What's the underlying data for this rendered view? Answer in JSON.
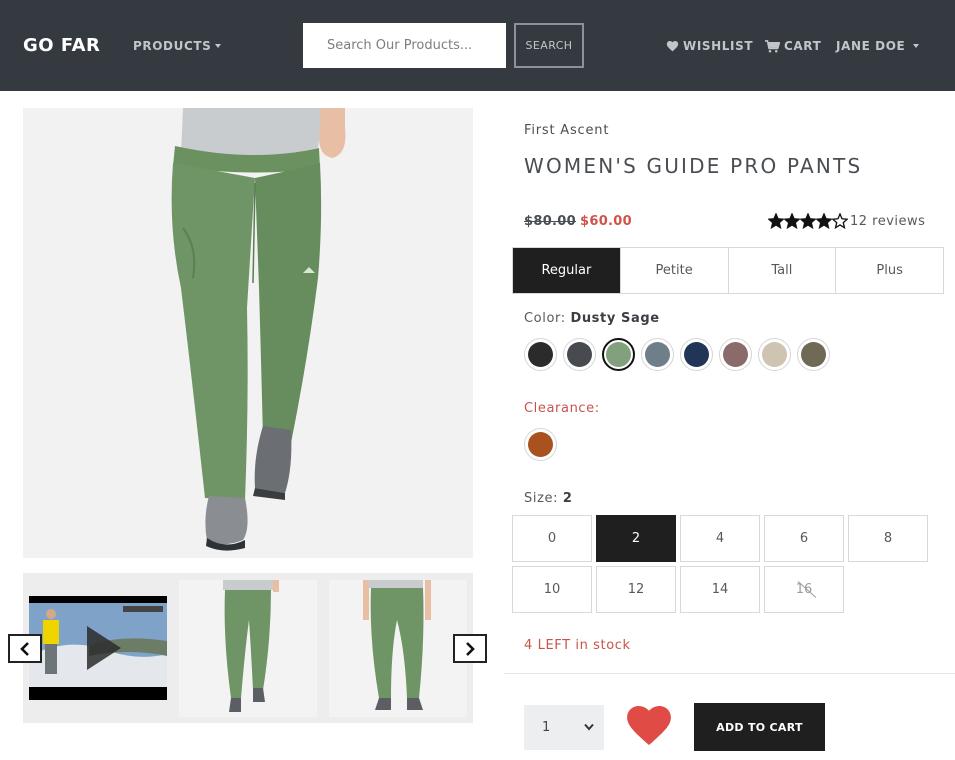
{
  "nav": {
    "brand": "GO FAR",
    "products_label": "PRODUCTS",
    "search_placeholder": "Search Our Products...",
    "search_button": "SEARCH",
    "wishlist_label": "WISHLIST",
    "cart_label": "CART",
    "user_label": "JANE DOE"
  },
  "gallery": {
    "thumbnails": [
      "video",
      "pants-front",
      "pants-back"
    ],
    "colors": {
      "background": "#f2f2f2",
      "pants": "#6e9465"
    }
  },
  "product": {
    "brand": "First Ascent",
    "title": "WOMEN'S GUIDE PRO PANTS",
    "price_old": "$80.00",
    "price_new": "$60.00",
    "rating": 4,
    "rating_max": 5,
    "reviews_label": "12 reviews",
    "fit_tabs": [
      {
        "label": "Regular",
        "active": true
      },
      {
        "label": "Petite",
        "active": false
      },
      {
        "label": "Tall",
        "active": false
      },
      {
        "label": "Plus",
        "active": false
      }
    ],
    "color_label": "Color:",
    "color_selected": "Dusty Sage",
    "colors": [
      {
        "hex": "#2b2b2b",
        "selected": false
      },
      {
        "hex": "#474a4e",
        "selected": false
      },
      {
        "hex": "#83a07e",
        "selected": true
      },
      {
        "hex": "#6f7f8a",
        "selected": false
      },
      {
        "hex": "#213657",
        "selected": false
      },
      {
        "hex": "#8a6a6a",
        "selected": false
      },
      {
        "hex": "#cfc3b1",
        "selected": false
      },
      {
        "hex": "#6e6a56",
        "selected": false
      }
    ],
    "clearance_label": "Clearance:",
    "clearance_colors": [
      {
        "hex": "#a9521f"
      }
    ],
    "size_label": "Size:",
    "size_selected": "2",
    "sizes": [
      {
        "label": "0",
        "state": "available"
      },
      {
        "label": "2",
        "state": "selected"
      },
      {
        "label": "4",
        "state": "available"
      },
      {
        "label": "6",
        "state": "available"
      },
      {
        "label": "8",
        "state": "available"
      },
      {
        "label": "10",
        "state": "available"
      },
      {
        "label": "12",
        "state": "available"
      },
      {
        "label": "14",
        "state": "available"
      },
      {
        "label": "16",
        "state": "unavailable"
      }
    ],
    "stock_label": "4 LEFT in stock",
    "quantity": "1",
    "add_to_cart_label": "ADD TO CART"
  },
  "colors": {
    "navbar": "#343a40",
    "accent_red": "#d0534a",
    "dark_button": "#1f1f1f",
    "heart": "#e04b45"
  }
}
